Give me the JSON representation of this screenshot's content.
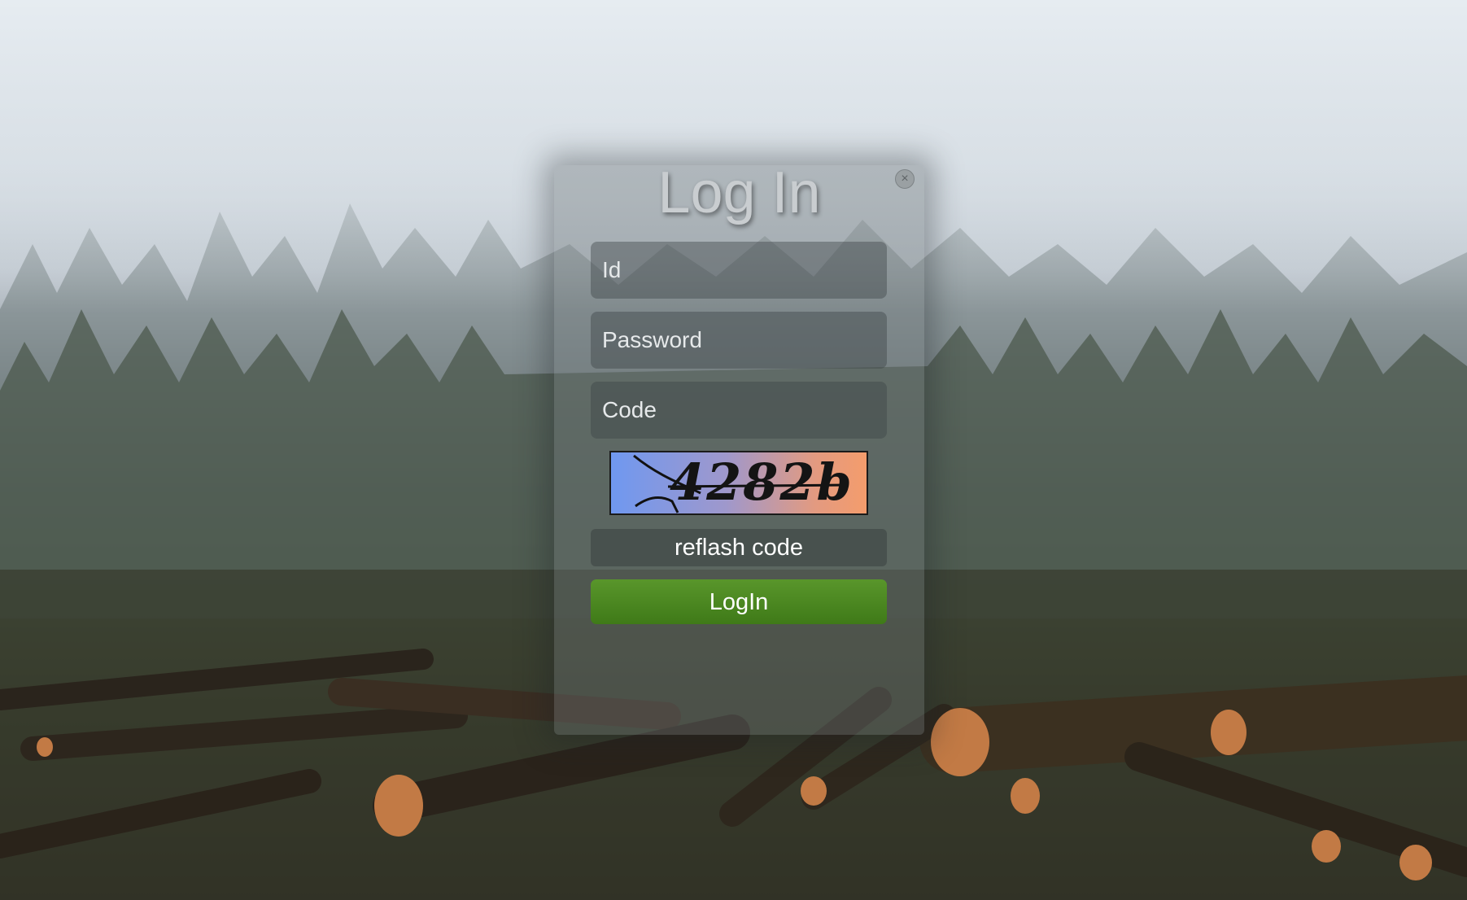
{
  "dialog": {
    "title": "Log In",
    "close_icon": "close-icon",
    "id_placeholder": "Id",
    "password_placeholder": "Password",
    "code_placeholder": "Code",
    "captcha_text": "4282b",
    "reflash_label": "reflash code",
    "login_label": "LogIn"
  },
  "colors": {
    "login_button": "#4a8a20",
    "captcha_left": "#6f98f0",
    "captcha_right": "#f49c6c"
  }
}
